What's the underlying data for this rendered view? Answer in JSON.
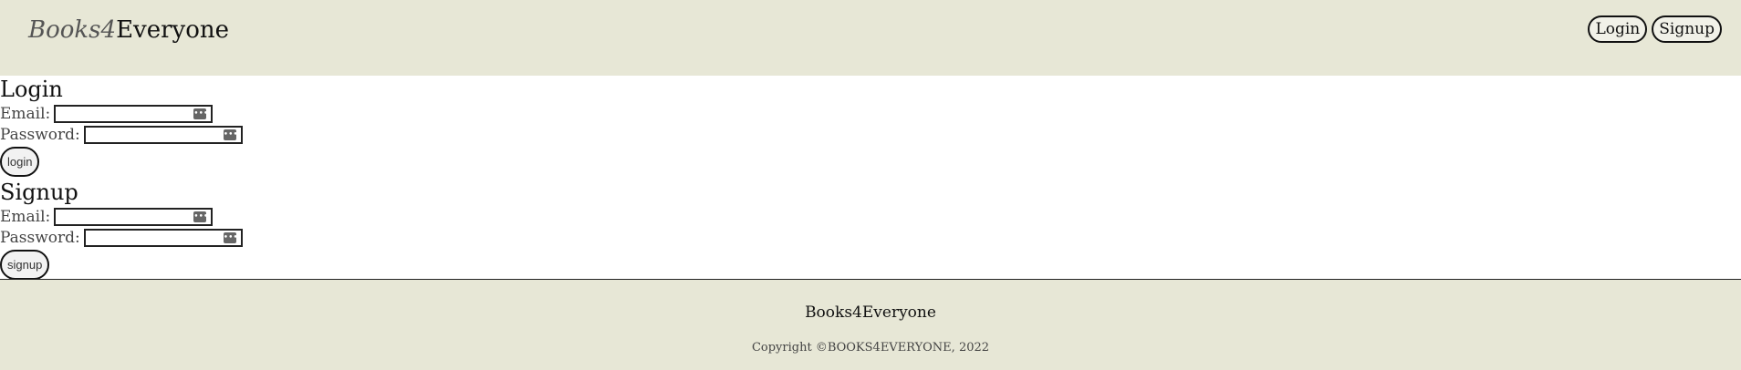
{
  "header": {
    "brand_italic": "Books4",
    "brand_rest": "Everyone",
    "nav": {
      "login": "Login",
      "signup": "Signup"
    }
  },
  "login": {
    "title": "Login",
    "email_label": "Email:",
    "password_label": "Password:",
    "button": "login"
  },
  "signup": {
    "title": "Signup",
    "email_label": "Email:",
    "password_label": "Password:",
    "button": "signup"
  },
  "footer": {
    "brand": "Books4Everyone",
    "copyright": "Copyright ©BOOKS4EVERYONE, 2022"
  },
  "colors": {
    "header_bg": "#e7e7d6",
    "footer_bg": "#e7e7d6",
    "text": "#222222"
  }
}
